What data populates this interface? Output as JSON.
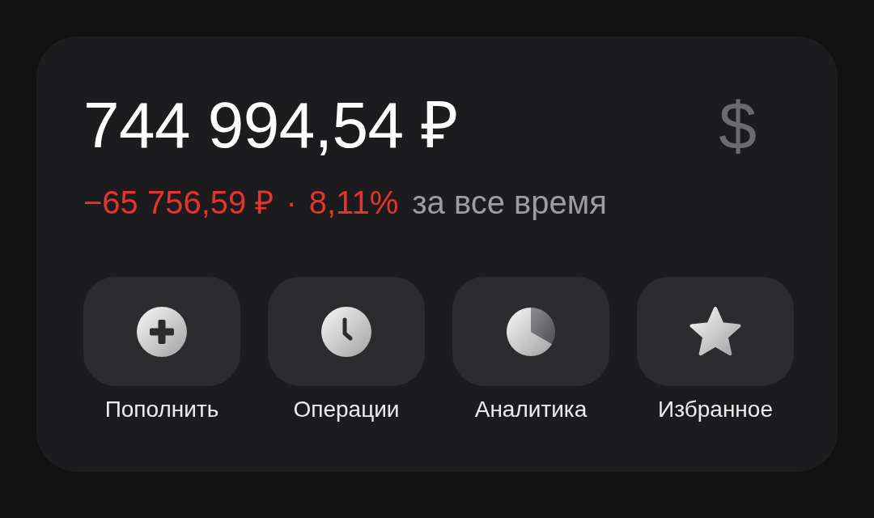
{
  "balance": {
    "amount": "744 994,54 ₽",
    "currency_toggle": "$"
  },
  "change": {
    "amount": "−65 756,59 ₽",
    "separator": "·",
    "percent": "8,11%",
    "period": "за все время",
    "negative": true
  },
  "actions": [
    {
      "kind": "plus",
      "label": "Пополнить"
    },
    {
      "kind": "clock",
      "label": "Операции"
    },
    {
      "kind": "pie",
      "label": "Аналитика"
    },
    {
      "kind": "star",
      "label": "Избранное"
    }
  ]
}
